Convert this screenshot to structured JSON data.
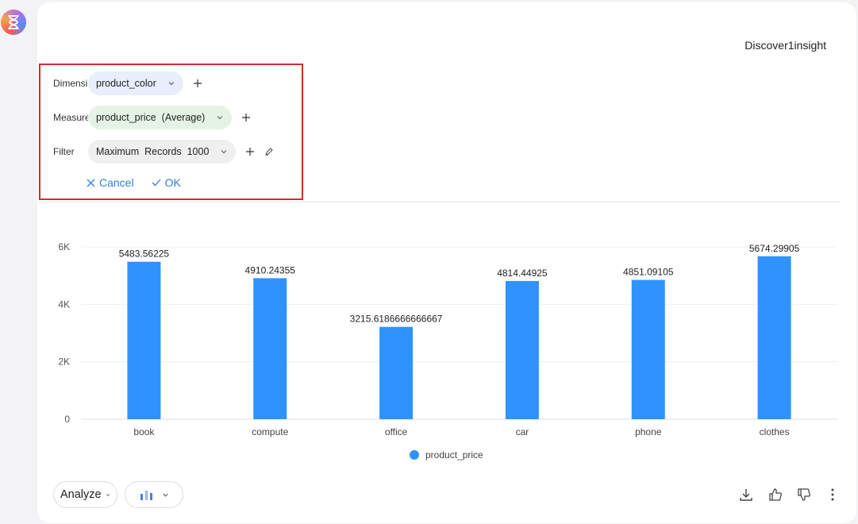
{
  "colors": {
    "accent": "#2f7fd8",
    "bar": "#2e93ff",
    "highlight_border": "#d62b2b"
  },
  "app": {
    "logo_icon": "hourglass-icon"
  },
  "insight": {
    "title": "Discover1insight"
  },
  "config": {
    "dimension": {
      "label": "Dimension",
      "value": "product_color"
    },
    "measure": {
      "label": "Measure",
      "value": "product_price  (Average)"
    },
    "filter": {
      "label": "Filter",
      "value": "Maximum  Records  1000"
    },
    "cancel_label": "Cancel",
    "ok_label": "OK"
  },
  "chart_data": {
    "type": "bar",
    "categories": [
      "book",
      "compute",
      "office",
      "car",
      "phone",
      "clothes"
    ],
    "series": [
      {
        "name": "product_price",
        "values": [
          5483.56225,
          4910.24355,
          3215.6186666666667,
          4814.44925,
          4851.09105,
          5674.29905
        ]
      }
    ],
    "data_labels": [
      "5483.56225",
      "4910.24355",
      "3215.6186666666667",
      "4814.44925",
      "4851.09105",
      "5674.29905"
    ],
    "y_ticks": [
      "0",
      "2K",
      "4K",
      "6K"
    ],
    "ylim": [
      0,
      6000
    ],
    "grid": true,
    "legend": "bottom-center"
  },
  "footer": {
    "analyze_label": "Analyze",
    "icons": [
      "download-icon",
      "thumbs-up-icon",
      "thumbs-down-icon",
      "more-icon"
    ]
  }
}
